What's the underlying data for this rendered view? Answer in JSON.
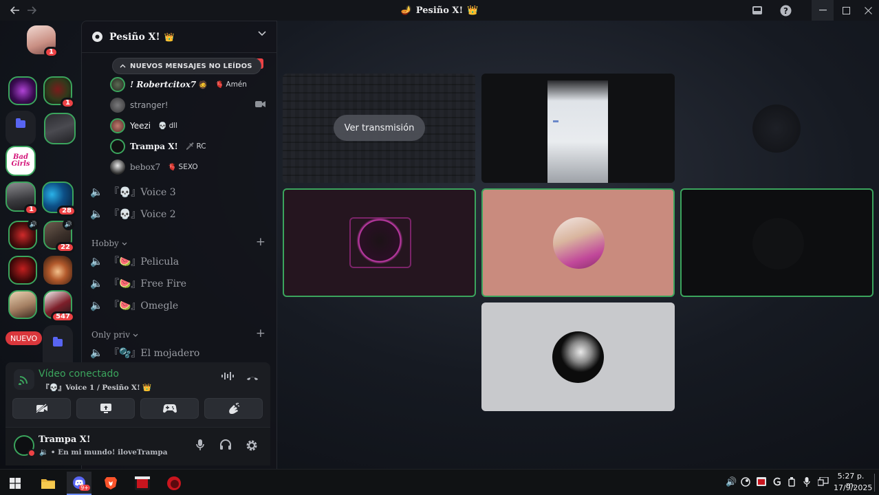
{
  "window": {
    "title": "Pesiño X!",
    "title_prefix_icon": "lamp-icon",
    "title_suffix_icon": "crown-icon",
    "back_icon": "arrow-left-icon",
    "forward_icon": "arrow-right-icon",
    "inbox_icon": "inbox-icon",
    "help_icon": "help-icon",
    "minimize_icon": "minimize-icon",
    "maximize_icon": "maximize-icon",
    "close_icon": "close-icon"
  },
  "rail": {
    "home_badge": "1",
    "badges": [
      "1",
      "1",
      "28",
      "22",
      "547"
    ],
    "nuevo_label": "NUEVO",
    "bad_girls_label": "Bad Girls"
  },
  "server": {
    "name": "Pesiño X!",
    "crown": "👑"
  },
  "new_messages_label": "NUEVOS MENSAJES NO LEÍDOS",
  "live_tag": "C TO",
  "members": [
    {
      "name": "! Robertcitox7",
      "emoji": "🧔",
      "tag_icon": "🫀",
      "tag": "Amén",
      "style": "bold-italic"
    },
    {
      "name": "stranger!",
      "emoji": "",
      "tag_icon": "",
      "tag": "",
      "style": "dim"
    },
    {
      "name": "Yeezi",
      "emoji": "",
      "tag_icon": "💀",
      "tag": "dll",
      "style": "normal"
    },
    {
      "name": "Trampa X!",
      "emoji": "",
      "tag_icon": "🗡",
      "tag": "RC",
      "style": "serif-bold"
    },
    {
      "name": "bebox7",
      "emoji": "",
      "tag_icon": "🫀",
      "tag": "SEXO",
      "style": "dim"
    }
  ],
  "voice_channels": [
    {
      "name": "『💀』Voice 3"
    },
    {
      "name": "『💀』Voice 2"
    }
  ],
  "categories": [
    {
      "name": "Hobby",
      "channels": [
        "『🍉』Pelicula",
        "『🍉』Free Fire",
        "『🍉』Omegle"
      ]
    },
    {
      "name": "Only priv",
      "channels": [
        "『🫧』El mojadero"
      ]
    }
  ],
  "rtc": {
    "status": "Vídeo conectado",
    "channel": "『💀』Voice 1 / Pesiño X! 👑",
    "buttons": [
      "camera-off-icon",
      "screen-share-icon",
      "activity-icon",
      "soundboard-icon"
    ]
  },
  "user": {
    "name": "Trampa X!",
    "custom_status": "🔉 • En mi mundo! iloveTrampa"
  },
  "stage": {
    "watch_label": "Ver transmisión"
  },
  "taskbar": {
    "discord_badge": "9+",
    "time": "5:27 p. m.",
    "date": "17/9/2025"
  },
  "colors": {
    "accent_green": "#3ba55d",
    "danger_red": "#ed4245",
    "blurple": "#5865f2"
  }
}
